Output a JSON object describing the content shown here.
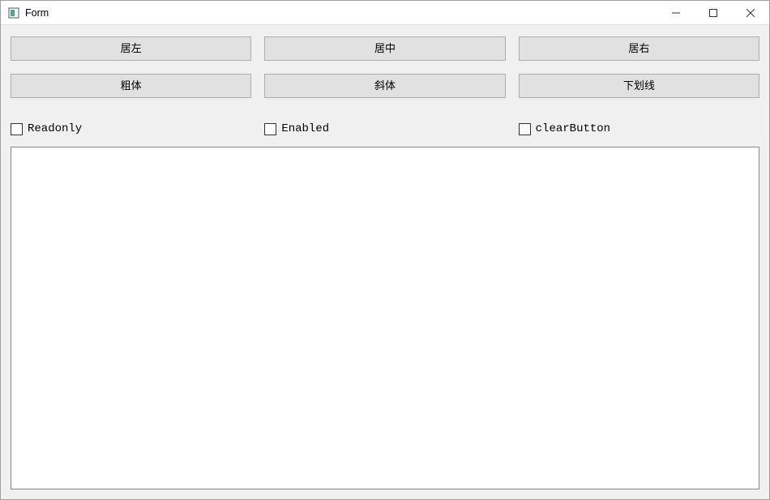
{
  "window": {
    "title": "Form"
  },
  "buttons_row1": {
    "left": "居左",
    "center": "居中",
    "right": "居右"
  },
  "buttons_row2": {
    "bold": "粗体",
    "italic": "斜体",
    "underline": "下划线"
  },
  "checkboxes": {
    "readonly": "Readonly",
    "enabled": "Enabled",
    "clearbutton": "clearButton"
  },
  "textarea": {
    "value": ""
  }
}
